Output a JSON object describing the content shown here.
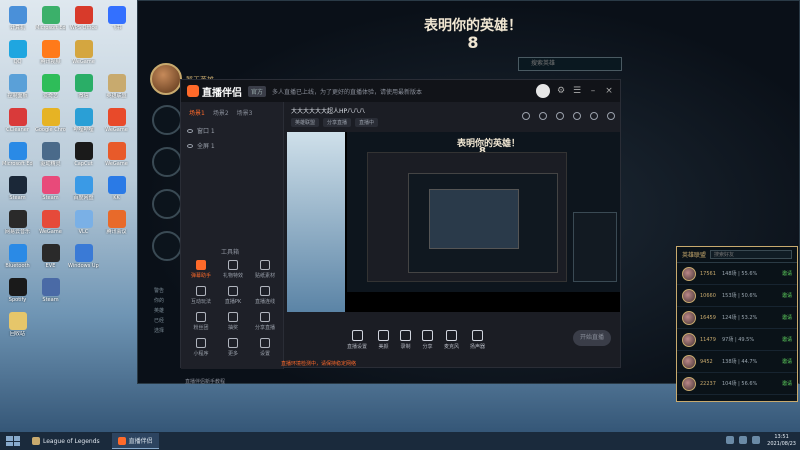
{
  "desktop": {
    "icons": [
      {
        "label": "计算机",
        "color": "#4a90d9"
      },
      {
        "label": "Microsoft Edge",
        "color": "#3bb06a"
      },
      {
        "label": "WPS Office",
        "color": "#d83a2a"
      },
      {
        "label": "飞书",
        "color": "#3370ff"
      },
      {
        "label": "QQ",
        "color": "#1fa6e0"
      },
      {
        "label": "腾讯视频",
        "color": "#ff7a1a"
      },
      {
        "label": "WeGame",
        "color": "#d4a640"
      },
      {
        "label": "",
        "color": ""
      },
      {
        "label": "控制面板",
        "color": "#5aa0d8"
      },
      {
        "label": "爱奇艺",
        "color": "#2ebd59"
      },
      {
        "label": "微信",
        "color": "#2aae67"
      },
      {
        "label": "英雄联盟",
        "color": "#c8aa6e"
      },
      {
        "label": "CCleaner",
        "color": "#d93a3a"
      },
      {
        "label": "Google Chrome",
        "color": "#e6b324"
      },
      {
        "label": "哔哩哔哩",
        "color": "#2a9fd6"
      },
      {
        "label": "WeGame",
        "color": "#e84a2a"
      },
      {
        "label": "Microsoft Edge",
        "color": "#2a8ae6"
      },
      {
        "label": "驱动精灵",
        "color": "#4a6a8a"
      },
      {
        "label": "CapCut",
        "color": "#1a1a1a"
      },
      {
        "label": "WeGame",
        "color": "#e85a2a"
      },
      {
        "label": "Steam",
        "color": "#1b2838"
      },
      {
        "label": "Steam",
        "color": "#e84a7a"
      },
      {
        "label": "百度网盘",
        "color": "#3a9ae6"
      },
      {
        "label": "KK",
        "color": "#2a7ae6"
      },
      {
        "label": "网易云音乐",
        "color": "#2a2a2a"
      },
      {
        "label": "WeGame",
        "color": "#e64a3a"
      },
      {
        "label": "VLC",
        "color": "#7ab0e6"
      },
      {
        "label": "腾讯会议",
        "color": "#e86a2a"
      },
      {
        "label": "Bluetooth",
        "color": "#2a8ae6"
      },
      {
        "label": "EVE",
        "color": "#2a2a2a"
      },
      {
        "label": "Windows Update",
        "color": "#3a7ad6"
      },
      {
        "label": "",
        "color": ""
      },
      {
        "label": "Spotify",
        "color": "#1a1a1a"
      },
      {
        "label": "Steam",
        "color": "#4a6aa6"
      },
      {
        "label": "",
        "color": ""
      },
      {
        "label": "",
        "color": ""
      },
      {
        "label": "回收站",
        "color": "#e6c66a"
      }
    ]
  },
  "game": {
    "title": "表明你的英雄！",
    "timer": "8",
    "search_placeholder": "搜索英雄",
    "champion_label": "暂无英雄",
    "chat_lines": [
      "警告",
      "你的",
      "英雄",
      "已经",
      "选择"
    ]
  },
  "stream": {
    "app_name": "直播伴侣",
    "badge": "官方",
    "notice": "多人直播已上线，为了更好的直播体验，请使用最新版本",
    "tabs": [
      "场景1",
      "场景2",
      "场景3"
    ],
    "sources": [
      "窗口 1",
      "全屏 1"
    ],
    "toolbox_label": "工具箱",
    "tools": [
      "弹幕助手",
      "礼物特效",
      "贴纸素材",
      "互动玩法",
      "直播PK",
      "直播连线",
      "粉丝团",
      "抽奖",
      "分享直播",
      "小程序",
      "更多",
      "设置"
    ],
    "footer": "直播伴侣新手教程",
    "room_title": "大大大大大大超人HP八八八",
    "room_tags": [
      "英雄联盟",
      "分享直播",
      "直播中"
    ],
    "preview_title": "表明你的英雄！",
    "preview_timer": "8",
    "bar_buttons": [
      "直播设置",
      "美颜",
      "录制",
      "分享",
      "麦克风",
      "扬声器"
    ],
    "go_live": "开始直播",
    "warning": "直播环境检测中，请保持稳定网络"
  },
  "friends": {
    "title": "英雄联盟",
    "search_placeholder": "搜索好友",
    "rows": [
      {
        "score": "17561",
        "stat": "148场 | 55.6%",
        "action": "邀请"
      },
      {
        "score": "10660",
        "stat": "153场 | 50.6%",
        "action": "邀请"
      },
      {
        "score": "16459",
        "stat": "124场 | 53.2%",
        "action": "邀请"
      },
      {
        "score": "11479",
        "stat": "97场 | 49.5%",
        "action": "邀请"
      },
      {
        "score": "9452",
        "stat": "138场 | 44.7%",
        "action": "邀请"
      },
      {
        "score": "22237",
        "stat": "104场 | 56.6%",
        "action": "邀请"
      }
    ]
  },
  "taskbar": {
    "items": [
      {
        "label": "League of Legends",
        "color": "#c8aa6e"
      },
      {
        "label": "直播伴侣",
        "color": "#ff6a2a"
      }
    ],
    "time": "13:51",
    "date": "2021/08/23"
  }
}
